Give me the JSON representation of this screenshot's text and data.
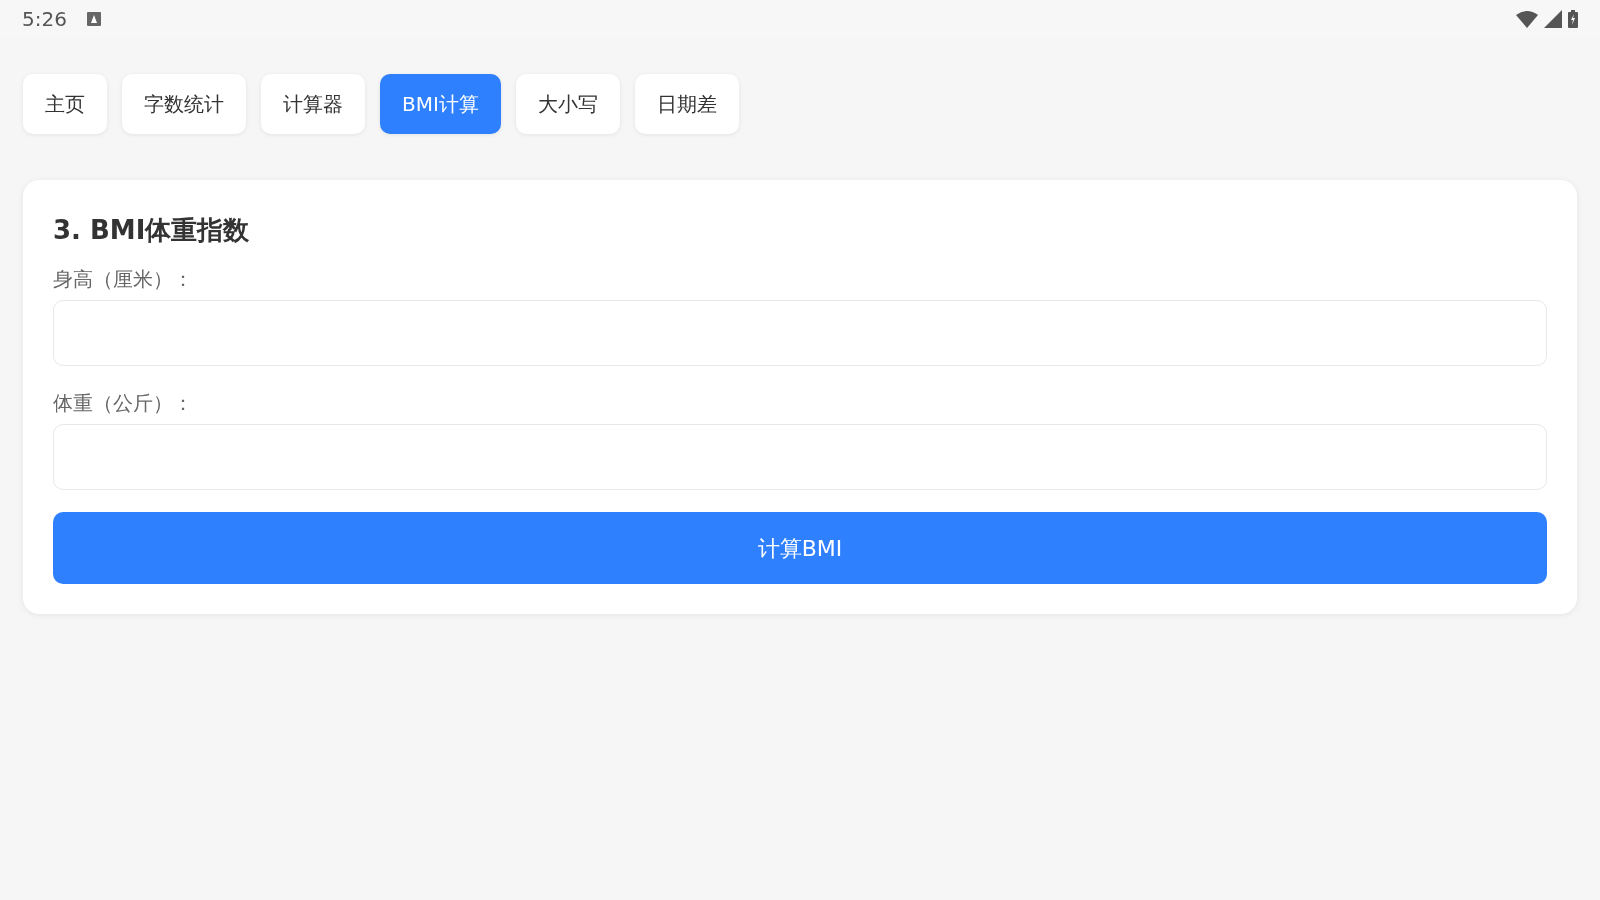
{
  "status_bar": {
    "time": "5:26"
  },
  "tabs": [
    {
      "label": "主页",
      "selected": false
    },
    {
      "label": "字数统计",
      "selected": false
    },
    {
      "label": "计算器",
      "selected": false
    },
    {
      "label": "BMI计算",
      "selected": true
    },
    {
      "label": "大小写",
      "selected": false
    },
    {
      "label": "日期差",
      "selected": false
    }
  ],
  "card": {
    "title": "3. BMI体重指数",
    "fields": [
      {
        "label": "身高（厘米）："
      },
      {
        "label": "体重（公斤）："
      }
    ],
    "button": "计算BMI"
  }
}
